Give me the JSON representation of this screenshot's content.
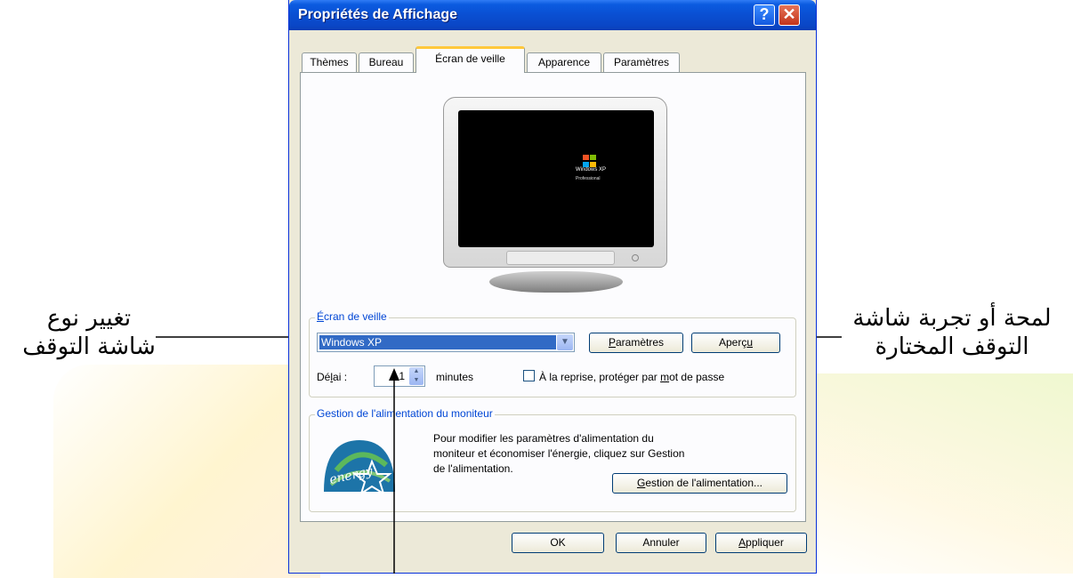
{
  "annotations": {
    "left_line1": "تغيير نوع",
    "left_line2": "شاشة التوقف",
    "right_line1": "لمحة أو تجربة شاشة",
    "right_line2": "التوقف المختارة"
  },
  "dialog": {
    "title": "Propriétés de Affichage",
    "help_glyph": "?",
    "close_glyph": "✕"
  },
  "tabs": [
    {
      "label": "Thèmes"
    },
    {
      "label": "Bureau"
    },
    {
      "label": "Écran de veille"
    },
    {
      "label": "Apparence"
    },
    {
      "label": "Paramètres"
    }
  ],
  "monitor_logo": {
    "brand": "Windows XP",
    "edition": "Professional",
    "colors": [
      "#f35325",
      "#81bc06",
      "#05a6f0",
      "#ffba08"
    ]
  },
  "screensaver": {
    "group_title_accesskey": "É",
    "group_title_rest": "cran de veille",
    "selected": "Windows XP",
    "settings_accesskey": "P",
    "settings_rest": "aramètres",
    "preview_prefix": "Aperç",
    "preview_accesskey": "u",
    "delay_prefix": "Dé",
    "delay_accesskey": "l",
    "delay_suffix": "ai :",
    "delay_value": "1",
    "delay_unit": "minutes",
    "password_prefix": "À la reprise, protéger par ",
    "password_accesskey": "m",
    "password_suffix": "ot de passe",
    "password_checked": false
  },
  "power": {
    "group_title": "Gestion de l'alimentation du moniteur",
    "description": "Pour modifier les paramètres d'alimentation du moniteur et économiser l'énergie, cliquez sur Gestion de l'alimentation.",
    "logo_text": "energy",
    "button_accesskey": "G",
    "button_rest": "estion de l'alimentation..."
  },
  "footer": {
    "ok": "OK",
    "cancel": "Annuler",
    "apply_accesskey": "A",
    "apply_rest": "ppliquer"
  }
}
